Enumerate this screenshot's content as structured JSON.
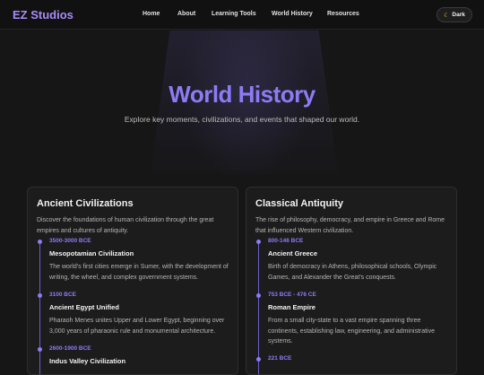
{
  "nav": {
    "brand": "EZ Studios",
    "links": [
      "Home",
      "About",
      "Learning Tools",
      "World History",
      "Resources"
    ],
    "theme_button": "Dark"
  },
  "hero": {
    "title": "World History",
    "subtitle": "Explore key moments, civilizations, and events that shaped our world."
  },
  "cards": [
    {
      "title": "Ancient Civilizations",
      "description": "Discover the foundations of human civilization through the great empires and cultures of antiquity.",
      "entries": [
        {
          "date": "3500-3000 BCE",
          "title": "Mesopotamian Civilization",
          "text": "The world's first cities emerge in Sumer, with the development of writing, the wheel, and complex government systems."
        },
        {
          "date": "3100 BCE",
          "title": "Ancient Egypt Unified",
          "text": "Pharaoh Menes unites Upper and Lower Egypt, beginning over 3,000 years of pharaonic rule and monumental architecture."
        },
        {
          "date": "2600-1900 BCE",
          "title": "Indus Valley Civilization",
          "text": ""
        }
      ]
    },
    {
      "title": "Classical Antiquity",
      "description": "The rise of philosophy, democracy, and empire in Greece and Rome that influenced Western civilization.",
      "entries": [
        {
          "date": "800-146 BCE",
          "title": "Ancient Greece",
          "text": "Birth of democracy in Athens, philosophical schools, Olympic Games, and Alexander the Great's conquests."
        },
        {
          "date": "753 BCE - 476 CE",
          "title": "Roman Empire",
          "text": "From a small city-state to a vast empire spanning three continents, establishing law, engineering, and administrative systems."
        },
        {
          "date": "221 BCE",
          "title": "",
          "text": ""
        }
      ]
    }
  ]
}
